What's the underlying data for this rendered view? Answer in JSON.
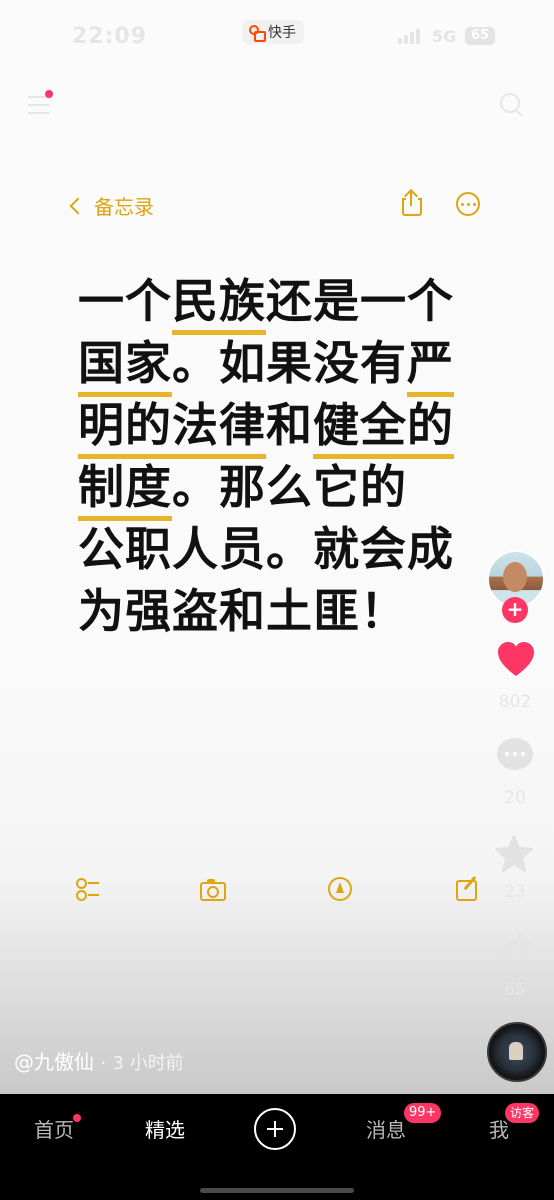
{
  "status_bar": {
    "time": "22:09",
    "network": "5G",
    "battery": "65"
  },
  "app": {
    "name": "快手"
  },
  "notes": {
    "back_label": "备忘录",
    "lines": [
      [
        {
          "t": "一个",
          "hl": false
        },
        {
          "t": "民族",
          "hl": true
        },
        {
          "t": "还是一个",
          "hl": false
        }
      ],
      [
        {
          "t": "国家",
          "hl": true
        },
        {
          "t": "。如果没有",
          "hl": false
        },
        {
          "t": "严",
          "hl": true
        }
      ],
      [
        {
          "t": "明的法律",
          "hl": true
        },
        {
          "t": "和",
          "hl": false
        },
        {
          "t": "健全的",
          "hl": true
        }
      ],
      [
        {
          "t": "制度",
          "hl": true
        },
        {
          "t": "。那么它的",
          "hl": false
        }
      ],
      [
        {
          "t": "公职人员。就会成",
          "hl": false
        }
      ],
      [
        {
          "t": "为强盗和土匪！",
          "hl": false
        }
      ]
    ]
  },
  "actions": {
    "likes": "802",
    "comments": "20",
    "favorites": "23",
    "shares": "65"
  },
  "video_info": {
    "author": "@九傲仙",
    "separator": "·",
    "posted": "3 小时前"
  },
  "nav": {
    "home": "首页",
    "featured": "精选",
    "messages": "消息",
    "messages_badge": "99+",
    "me": "我",
    "visitor_badge": "访客"
  },
  "colors": {
    "accent": "#fe3666",
    "notes_yellow": "#dea512",
    "highlight": "#e8b52a"
  }
}
